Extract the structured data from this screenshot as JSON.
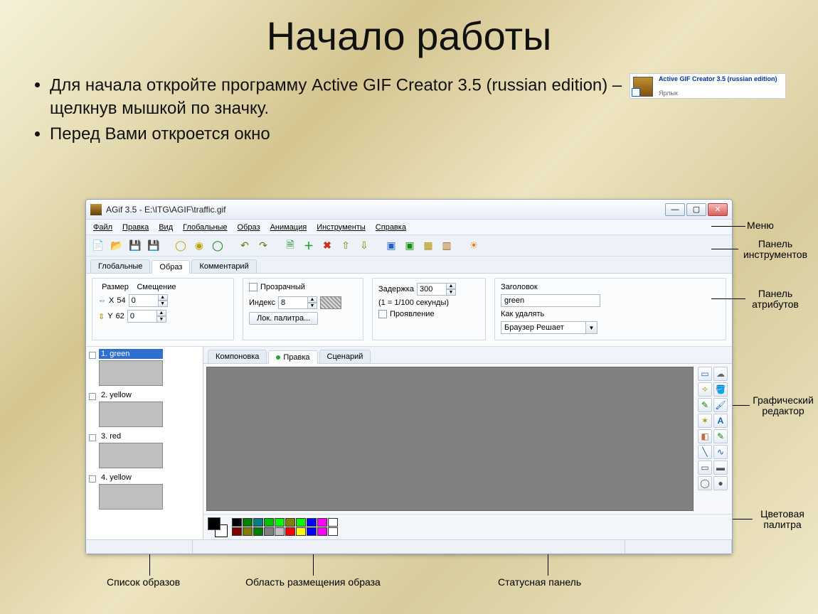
{
  "slide": {
    "title": "Начало работы",
    "bullet1_pre": "Для начала откройте программу  Active GIF Creator 3.5 (russian edition) – ",
    "bullet1_post": " щелкнув мышкой по значку.",
    "bullet2": "Перед Вами откроется окно",
    "shortcut": {
      "title": "Active GIF Creator 3.5 (russian edition)",
      "sub": "Ярлык"
    }
  },
  "callouts": {
    "menu": "Меню",
    "toolbar": "Панель инструментов",
    "attrs": "Панель атрибутов",
    "gfx": "Графический редактор",
    "palette": "Цветовая палитра",
    "framelist": "Список образов",
    "placement": "Область размещения образа",
    "status": "Статусная панель"
  },
  "window": {
    "title": "AGif 3.5 - E:\\ITG\\AGIF\\traffic.gif",
    "menu": {
      "file": "Файл",
      "edit": "Правка",
      "view": "Вид",
      "global": "Глобальные",
      "image": "Образ",
      "anim": "Анимация",
      "tools": "Инструменты",
      "help": "Справка"
    },
    "tabs": {
      "global": "Глобальные",
      "image": "Образ",
      "comment": "Комментарий"
    },
    "attrs": {
      "size_label": "Размер",
      "offset_label": "Смещение",
      "x_label": "X",
      "x_value": "54",
      "x_offset": "0",
      "y_label": "Y",
      "y_value": "62",
      "y_offset": "0",
      "transparent": "Прозрачный",
      "index_label": "Индекс",
      "index_value": "8",
      "local_palette_btn": "Лок. палитра...",
      "delay_label": "Задержка",
      "delay_value": "300",
      "delay_hint": "(1 = 1/100 секунды)",
      "interlace": "Проявление",
      "title_label": "Заголовок",
      "title_value": "green",
      "disposal_label": "Как удалять",
      "disposal_value": "Браузер Решает"
    },
    "frames": [
      {
        "label": "1. green"
      },
      {
        "label": "2. yellow"
      },
      {
        "label": "3. red"
      },
      {
        "label": "4. yellow"
      }
    ],
    "subtabs": {
      "layout": "Компоновка",
      "edit": "Правка",
      "script": "Сценарий"
    },
    "palette": {
      "row1": [
        "#000000",
        "#008000",
        "#008080",
        "#00c000",
        "#00ff00",
        "#808000",
        "#00ff00",
        "#0000ff",
        "#ff00ff",
        "#ffffff"
      ],
      "row2": [
        "#800000",
        "#808000",
        "#008000",
        "#808080",
        "#c0c0c0",
        "#ff0000",
        "#ffff00",
        "#0000ff",
        "#ff00ff",
        "#ffffff"
      ]
    }
  }
}
